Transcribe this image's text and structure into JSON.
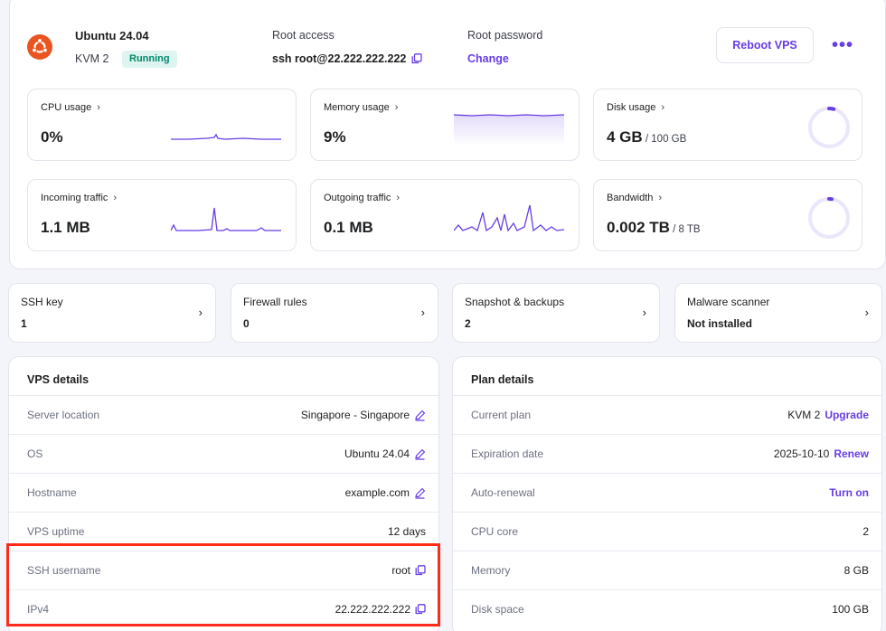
{
  "header": {
    "os_name": "Ubuntu 24.04",
    "plan": "KVM 2",
    "status": "Running",
    "root_access_label": "Root access",
    "root_access_value": "ssh root@22.222.222.222",
    "root_password_label": "Root password",
    "change_label": "Change",
    "reboot_label": "Reboot VPS",
    "more_label": "•••"
  },
  "metrics": [
    {
      "label": "CPU usage",
      "value": "0%",
      "sub": ""
    },
    {
      "label": "Memory usage",
      "value": "9%",
      "sub": ""
    },
    {
      "label": "Disk usage",
      "value": "4 GB",
      "sub": " / 100 GB",
      "fraction": 0.04
    },
    {
      "label": "Incoming traffic",
      "value": "1.1 MB",
      "sub": ""
    },
    {
      "label": "Outgoing traffic",
      "value": "0.1 MB",
      "sub": ""
    },
    {
      "label": "Bandwidth",
      "value": "0.002 TB",
      "sub": " / 8 TB",
      "fraction": 0.0003
    }
  ],
  "quick": [
    {
      "label": "SSH key",
      "value": "1"
    },
    {
      "label": "Firewall rules",
      "value": "0"
    },
    {
      "label": "Snapshot & backups",
      "value": "2"
    },
    {
      "label": "Malware scanner",
      "value": "Not installed"
    }
  ],
  "vps_details": {
    "title": "VPS details",
    "rows": [
      {
        "label": "Server location",
        "value": "Singapore - Singapore"
      },
      {
        "label": "OS",
        "value": "Ubuntu 24.04"
      },
      {
        "label": "Hostname",
        "value": "example.com"
      },
      {
        "label": "VPS uptime",
        "value": "12 days"
      },
      {
        "label": "SSH username",
        "value": "root"
      },
      {
        "label": "IPv4",
        "value": "22.222.222.222"
      }
    ]
  },
  "plan_details": {
    "title": "Plan details",
    "rows": [
      {
        "label": "Current plan",
        "value": "KVM 2",
        "link": "Upgrade"
      },
      {
        "label": "Expiration date",
        "value": "2025-10-10",
        "link": "Renew"
      },
      {
        "label": "Auto-renewal",
        "value": "",
        "link": "Turn on"
      },
      {
        "label": "CPU core",
        "value": "2",
        "link": ""
      },
      {
        "label": "Memory",
        "value": "8 GB",
        "link": ""
      },
      {
        "label": "Disk space",
        "value": "100 GB",
        "link": ""
      }
    ]
  },
  "colors": {
    "accent": "#673de6",
    "running_bg": "#def4f0",
    "running_text": "#00896b",
    "ubuntu": "#e95420",
    "highlight": "#ff2a1a"
  }
}
